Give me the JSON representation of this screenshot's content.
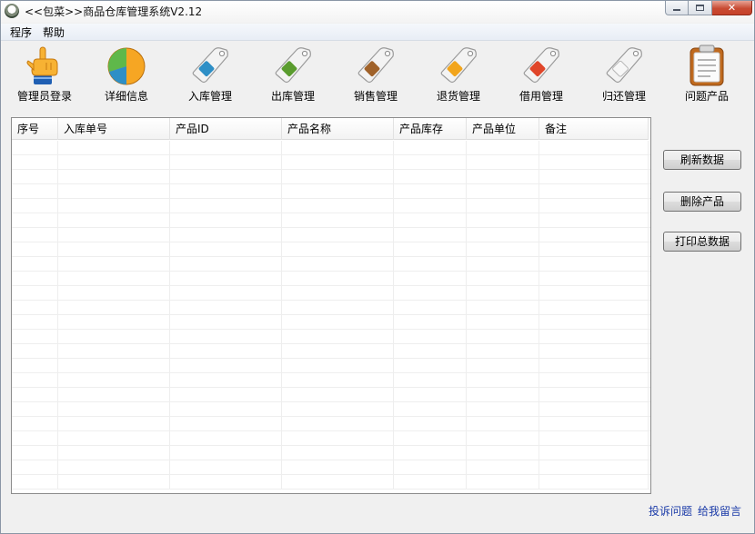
{
  "window": {
    "title": "<<包菜>>商品仓库管理系统V2.12",
    "close_label": "✕"
  },
  "menu": [
    "程序",
    "帮助"
  ],
  "toolbar": [
    {
      "label": "管理员登录",
      "icon": "hand-pointer-icon"
    },
    {
      "label": "详细信息",
      "icon": "pie-chart-icon"
    },
    {
      "label": "入库管理",
      "icon": "blue-tag-icon",
      "color": "#2e8fc6"
    },
    {
      "label": "出库管理",
      "icon": "green-tag-icon",
      "color": "#5a9c2e"
    },
    {
      "label": "销售管理",
      "icon": "brown-tag-icon",
      "color": "#a0622a"
    },
    {
      "label": "退货管理",
      "icon": "yellow-tag-icon",
      "color": "#f2a51c"
    },
    {
      "label": "借用管理",
      "icon": "red-tag-icon",
      "color": "#e0462a"
    },
    {
      "label": "归还管理",
      "icon": "white-tag-icon",
      "color": "#f4f4f4"
    },
    {
      "label": "问题产品",
      "icon": "clipboard-icon"
    }
  ],
  "table": {
    "columns": [
      "序号",
      "入库单号",
      "产品ID",
      "产品名称",
      "产品库存",
      "产品单位",
      "备注"
    ]
  },
  "buttons": {
    "refresh": "刷新数据",
    "delete": "删除产品",
    "print": "打印总数据"
  },
  "links": {
    "complain": "投诉问题",
    "message": "给我留言"
  }
}
